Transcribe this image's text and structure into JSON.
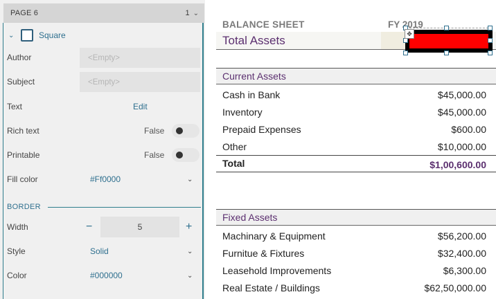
{
  "panel": {
    "page_title": "PAGE 6",
    "page_number": "1",
    "shape_label": "Square",
    "properties": {
      "author_label": "Author",
      "author_placeholder": "<Empty>",
      "subject_label": "Subject",
      "subject_placeholder": "<Empty>",
      "text_label": "Text",
      "text_action": "Edit",
      "rich_text_label": "Rich text",
      "rich_text_value": "False",
      "printable_label": "Printable",
      "printable_value": "False",
      "fill_color_label": "Fill color",
      "fill_color_value": "#Ff0000"
    },
    "border": {
      "section_label": "BORDER",
      "width_label": "Width",
      "width_value": "5",
      "style_label": "Style",
      "style_value": "Solid",
      "color_label": "Color",
      "color_value": "#000000"
    }
  },
  "sheet": {
    "title": "BALANCE SHEET",
    "fy_label": "FY 2019",
    "total_assets_label": "Total Assets",
    "current_assets": {
      "header": "Current Assets",
      "rows": [
        {
          "name": "Cash in Bank",
          "amount": "$45,000.00"
        },
        {
          "name": "Inventory",
          "amount": "$45,000.00"
        },
        {
          "name": "Prepaid Expenses",
          "amount": "$600.00"
        },
        {
          "name": "Other",
          "amount": "$10,000.00"
        }
      ],
      "total_label": "Total",
      "total_amount": "$1,00,600.00"
    },
    "fixed_assets": {
      "header": "Fixed Assets",
      "rows": [
        {
          "name": "Machinary & Equipment",
          "amount": "$56,200.00"
        },
        {
          "name": "Furnitue & Fixtures",
          "amount": "$32,400.00"
        },
        {
          "name": "Leasehold Improvements",
          "amount": "$6,300.00"
        },
        {
          "name": "Real Estate / Buildings",
          "amount": "$62,50,000.00"
        }
      ]
    }
  },
  "colors": {
    "accent": "#2e6f8e",
    "heading_purple": "#5b2f6f",
    "shape_fill": "#ff0000",
    "shape_border": "#000000"
  }
}
